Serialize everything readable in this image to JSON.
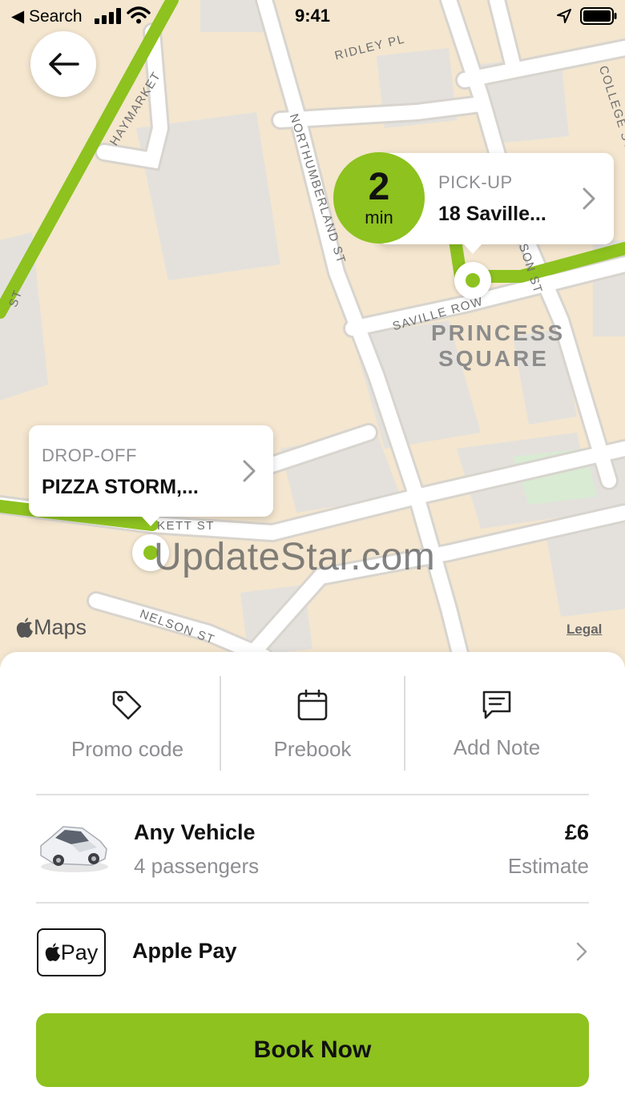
{
  "status_bar": {
    "back_app": "◀ Search",
    "time": "9:41"
  },
  "map": {
    "streets": [
      "RIDLEY PL",
      "HAYMARKET",
      "NORTHUMBERLAND ST",
      "COLLEGE ST",
      "SAVILLE ROW",
      "NELSON ST",
      "KETT ST",
      "SON ST",
      "ST"
    ],
    "area_label": "PRINCESS SQUARE",
    "eta": {
      "value": "2",
      "unit": "min"
    },
    "pickup": {
      "kicker": "PICK-UP",
      "place": "18 Saville..."
    },
    "dropoff": {
      "kicker": "DROP-OFF",
      "place": "PIZZA STORM,..."
    },
    "maps_logo": "Maps",
    "legal": "Legal",
    "watermark": "UpdateStar.com",
    "route_color": "#8dc21f"
  },
  "actions": [
    {
      "label": "Promo code",
      "icon": "tag-icon"
    },
    {
      "label": "Prebook",
      "icon": "calendar-icon"
    },
    {
      "label": "Add Note",
      "icon": "message-icon"
    }
  ],
  "vehicle": {
    "name": "Any Vehicle",
    "passengers": "4 passengers",
    "price": "£6",
    "price_note": "Estimate"
  },
  "payment": {
    "badge": "Pay",
    "method": "Apple Pay"
  },
  "book_button": "Book Now",
  "colors": {
    "accent": "#8dc21f",
    "map_bg": "#f4e6cf",
    "muted_text": "#8e8e93"
  }
}
